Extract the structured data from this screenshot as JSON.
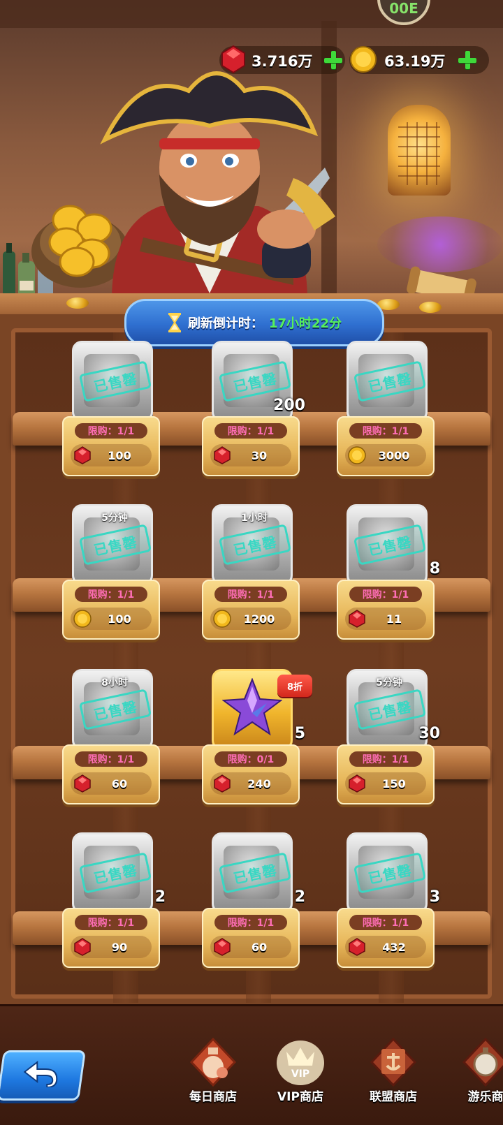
{
  "header": {
    "gems": {
      "value": "3.716万",
      "icon": "red-gem-icon"
    },
    "coins": {
      "value": "63.19万",
      "icon": "gold-coin-icon"
    },
    "avatar_text": "00E"
  },
  "timer": {
    "label": "刷新倒计时：",
    "value": "17小时22分"
  },
  "items": [
    {
      "top": "",
      "qty": "",
      "limit": "限购：1/1",
      "currency": "gem",
      "price": "100",
      "sold": true,
      "discount": ""
    },
    {
      "top": "",
      "qty": "200",
      "limit": "限购：1/1",
      "currency": "gem",
      "price": "30",
      "sold": true,
      "discount": ""
    },
    {
      "top": "",
      "qty": "",
      "limit": "限购：1/1",
      "currency": "coin",
      "price": "3000",
      "sold": true,
      "discount": ""
    },
    {
      "top": "5分钟",
      "qty": "",
      "limit": "限购：1/1",
      "currency": "coin",
      "price": "100",
      "sold": true,
      "discount": ""
    },
    {
      "top": "1小时",
      "qty": "",
      "limit": "限购：1/1",
      "currency": "coin",
      "price": "1200",
      "sold": true,
      "discount": ""
    },
    {
      "top": "",
      "qty": "8",
      "limit": "限购：1/1",
      "currency": "gem",
      "price": "11",
      "sold": true,
      "discount": ""
    },
    {
      "top": "8小时",
      "qty": "",
      "limit": "限购：1/1",
      "currency": "gem",
      "price": "60",
      "sold": true,
      "discount": ""
    },
    {
      "top": "",
      "qty": "5",
      "limit": "限购：0/1",
      "currency": "gem",
      "price": "240",
      "sold": false,
      "discount": "8折"
    },
    {
      "top": "5分钟",
      "qty": "30",
      "limit": "限购：1/1",
      "currency": "gem",
      "price": "150",
      "sold": true,
      "discount": ""
    },
    {
      "top": "",
      "qty": "2",
      "limit": "限购：1/1",
      "currency": "gem",
      "price": "90",
      "sold": true,
      "discount": ""
    },
    {
      "top": "",
      "qty": "2",
      "limit": "限购：1/1",
      "currency": "gem",
      "price": "60",
      "sold": true,
      "discount": ""
    },
    {
      "top": "",
      "qty": "3",
      "limit": "限购：1/1",
      "currency": "gem",
      "price": "432",
      "sold": true,
      "discount": ""
    }
  ],
  "sold_out_label": "已售罄",
  "nav": {
    "tabs": [
      {
        "label": "每日商店",
        "icon": "potion-shop-icon"
      },
      {
        "label": "VIP商店",
        "icon": "vip-crown-icon"
      },
      {
        "label": "联盟商店",
        "icon": "anchor-banner-icon"
      },
      {
        "label": "游乐商",
        "icon": "pocket-watch-icon"
      }
    ]
  },
  "colors": {
    "gem": "#d6202c",
    "coin": "#f2b81c",
    "accent_green": "#3fd93a",
    "banner_blue": "#2f6fd0",
    "sold_stamp": "#39d7c3"
  }
}
